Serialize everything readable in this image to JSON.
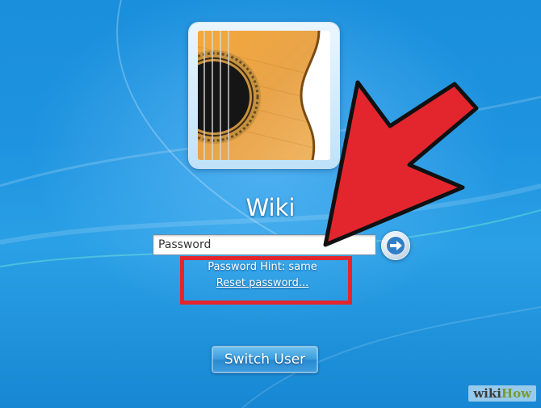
{
  "user": {
    "name": "Wiki",
    "avatar_icon": "guitar-avatar"
  },
  "password": {
    "placeholder": "Password",
    "hint": "Password Hint: same",
    "reset_link": "Reset password..."
  },
  "buttons": {
    "submit_icon": "arrow-right-icon",
    "switch_user": "Switch User"
  },
  "annotation": {
    "arrow_color": "#e3262e",
    "box_color": "#e3262e"
  },
  "watermark": {
    "part1": "wiki",
    "part2": "How"
  }
}
